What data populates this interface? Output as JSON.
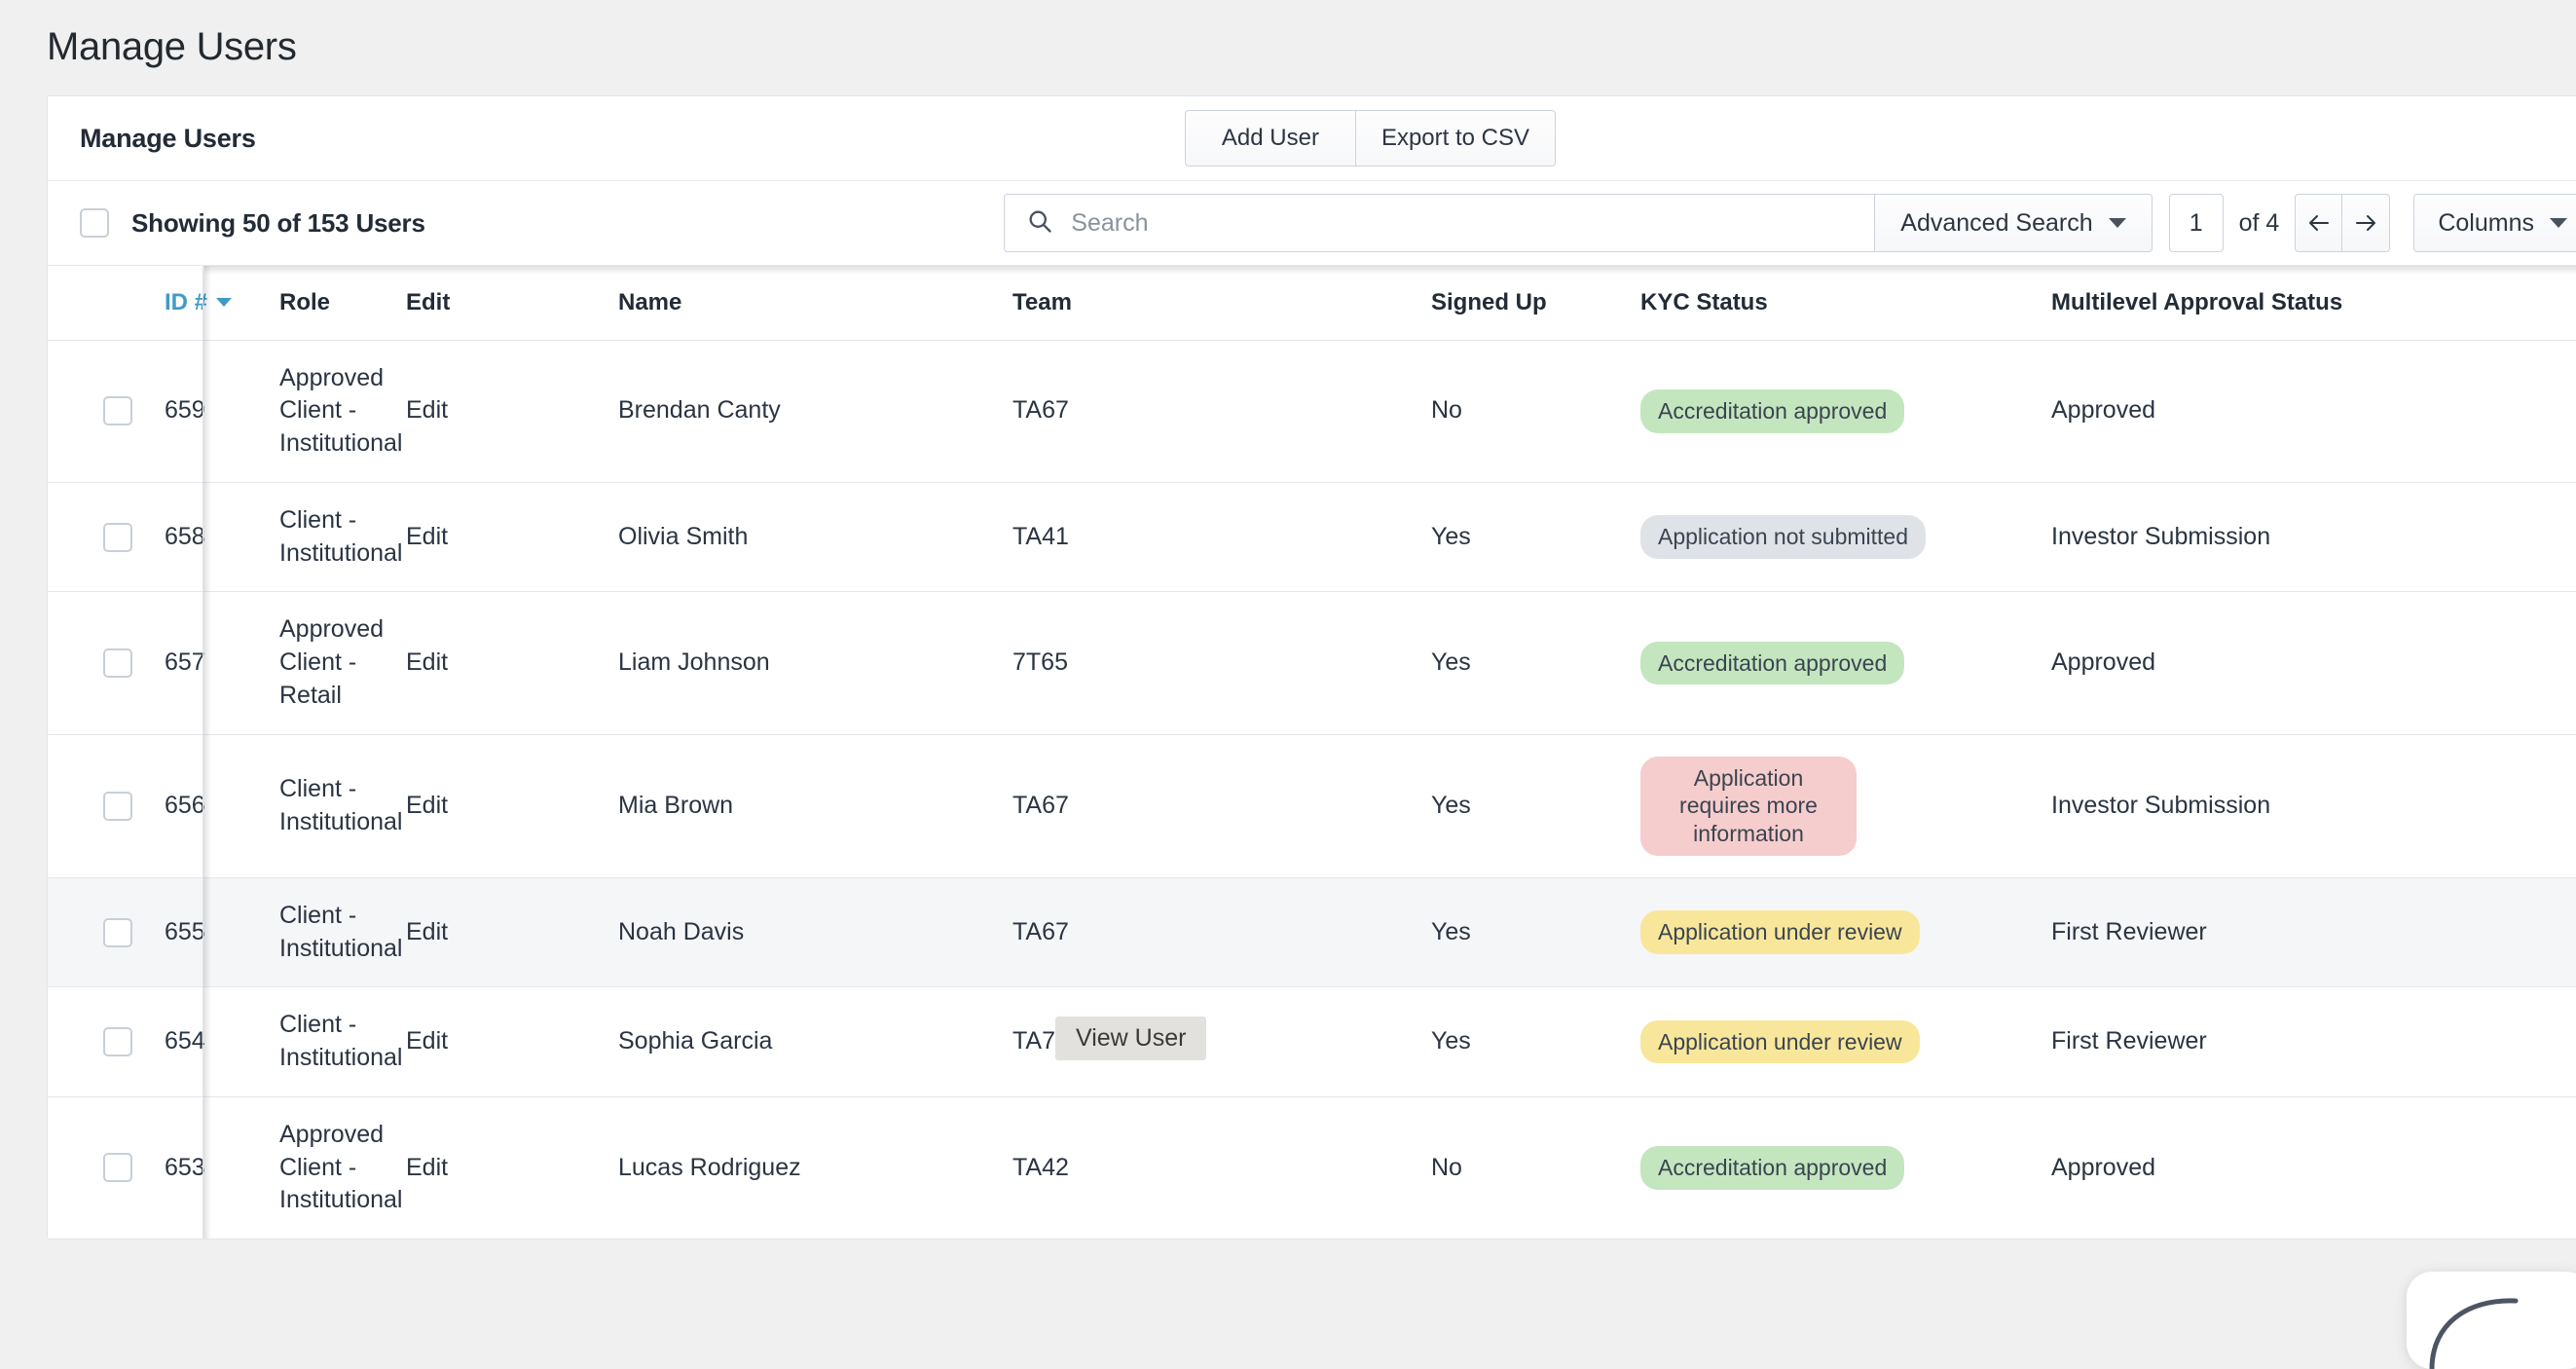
{
  "page": {
    "title": "Manage Users"
  },
  "card": {
    "title": "Manage Users",
    "actions": {
      "add_user": "Add User",
      "export_csv": "Export to CSV"
    }
  },
  "toolbar": {
    "showing_label": "Showing 50 of 153 Users",
    "search": {
      "placeholder": "Search",
      "value": ""
    },
    "advanced_search": "Advanced Search",
    "page_number": "1",
    "of_label": "of 4",
    "prev_arrow": "←",
    "next_arrow": "→",
    "columns": "Columns"
  },
  "table": {
    "columns": [
      {
        "key": "id",
        "label": "ID #",
        "sorted": true
      },
      {
        "key": "role",
        "label": "Role"
      },
      {
        "key": "edit",
        "label": "Edit"
      },
      {
        "key": "name",
        "label": "Name"
      },
      {
        "key": "team",
        "label": "Team"
      },
      {
        "key": "signed",
        "label": "Signed Up"
      },
      {
        "key": "kyc",
        "label": "KYC Status"
      },
      {
        "key": "ml",
        "label": "Multilevel Approval Status"
      }
    ],
    "rows": [
      {
        "id": "659",
        "role": "Approved Client - Institutional",
        "edit": "Edit",
        "name": "Brendan Canty",
        "team": "TA67",
        "signed": "No",
        "kyc": "Accreditation approved",
        "kyc_color": "green",
        "ml": "Approved",
        "hovered": false
      },
      {
        "id": "658",
        "role": "Client - Institutional",
        "edit": "Edit",
        "name": "Olivia Smith",
        "team": "TA41",
        "signed": "Yes",
        "kyc": "Application not submitted",
        "kyc_color": "gray",
        "ml": "Investor Submission",
        "hovered": false
      },
      {
        "id": "657",
        "role": "Approved Client - Retail",
        "edit": "Edit",
        "name": "Liam Johnson",
        "team": "7T65",
        "signed": "Yes",
        "kyc": "Accreditation approved",
        "kyc_color": "green",
        "ml": "Approved",
        "hovered": false
      },
      {
        "id": "656",
        "role": "Client - Institutional",
        "edit": "Edit",
        "name": "Mia Brown",
        "team": "TA67",
        "signed": "Yes",
        "kyc": "Application requires more information",
        "kyc_color": "pink",
        "ml": "Investor Submission",
        "hovered": false
      },
      {
        "id": "655",
        "role": "Client - Institutional",
        "edit": "Edit",
        "name": "Noah Davis",
        "team": "TA67",
        "signed": "Yes",
        "kyc": "Application under review",
        "kyc_color": "yellow",
        "ml": "First Reviewer",
        "hovered": true
      },
      {
        "id": "654",
        "role": "Client - Institutional",
        "edit": "Edit",
        "name": "Sophia Garcia",
        "team": "TA70",
        "signed": "Yes",
        "kyc": "Application under review",
        "kyc_color": "yellow",
        "ml": "First Reviewer",
        "hovered": false
      },
      {
        "id": "653",
        "role": "Approved Client - Institutional",
        "edit": "Edit",
        "name": "Lucas Rodriguez",
        "team": "TA42",
        "signed": "No",
        "kyc": "Accreditation approved",
        "kyc_color": "green",
        "ml": "Approved",
        "hovered": false
      }
    ]
  },
  "tooltip": {
    "text": "View User"
  },
  "colors": {
    "accent_blue": "#3f9bc6",
    "badge_green": "#c3e6bf",
    "badge_gray": "#dfe2e7",
    "badge_pink": "#f6cdcd",
    "badge_yellow": "#f8e79a",
    "page_bg": "#f0f0f0",
    "text": "#2b3442"
  }
}
